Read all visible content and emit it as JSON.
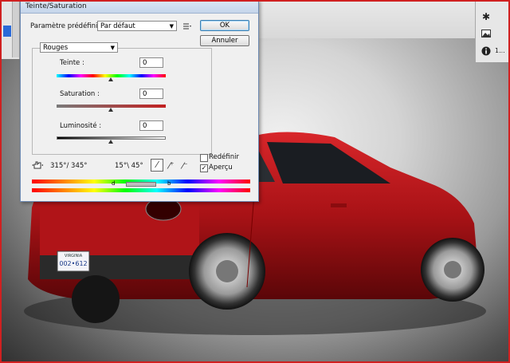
{
  "dialog": {
    "title": "Teinte/Saturation",
    "preset_label": "Paramètre prédéfini :",
    "preset_value": "Par défaut",
    "ok_label": "OK",
    "cancel_label": "Annuler",
    "channel_value": "Rouges",
    "hue_label": "Teinte :",
    "hue_value": "0",
    "saturation_label": "Saturation :",
    "saturation_value": "0",
    "lightness_label": "Luminosité :",
    "lightness_value": "0",
    "range_left": "315°/ 345°",
    "range_right": "15°\\ 45°",
    "colorize_label": "Redéfinir",
    "preview_label": "Aperçu",
    "colorize_checked": false,
    "preview_checked": true
  },
  "right_panel": {
    "items": [
      {
        "icon": "gear-icon",
        "label": ""
      },
      {
        "icon": "image-icon",
        "label": ""
      },
      {
        "icon": "info-icon",
        "label": "1..."
      }
    ]
  },
  "colors": {
    "car_body": "#b01418",
    "frame_border": "#d02020"
  },
  "license_plate": {
    "state": "VIRGINIA",
    "number": "002•612"
  }
}
